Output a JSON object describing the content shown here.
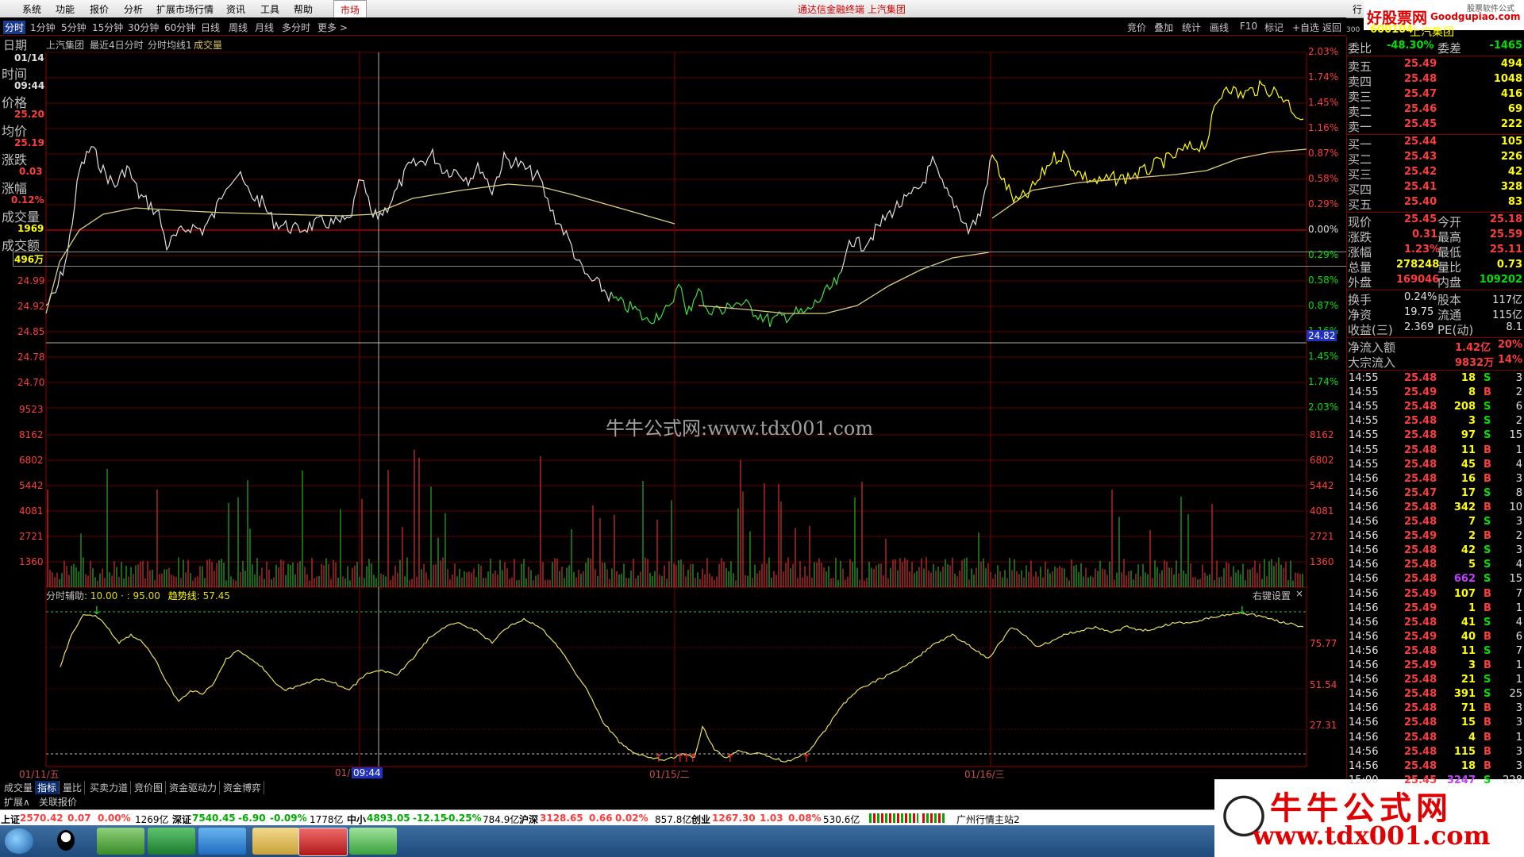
{
  "menu": {
    "items": [
      "系统",
      "功能",
      "报价",
      "分析",
      "扩展市场行情",
      "资讯",
      "工具",
      "帮助"
    ],
    "market_tab": "市场",
    "app_title": "通达信金融终端 上汽集团",
    "right_label": "行"
  },
  "top_logo": {
    "brand": "好股票网",
    "url": "Goodgupiao.com",
    "extra": "股票软件公式"
  },
  "toolbar": {
    "periods": [
      "分时",
      "1分钟",
      "5分钟",
      "15分钟",
      "30分钟",
      "60分钟",
      "日线",
      "周线",
      "月线",
      "多分时",
      "更多 >"
    ],
    "right": [
      "竞价",
      "叠加",
      "统计",
      "画线",
      "F10",
      "标记",
      "+自选",
      "返回"
    ]
  },
  "quote_header": {
    "code": "600104",
    "name": "上汽集团",
    "prefix": "300"
  },
  "chart_header": {
    "date_tab": "日期",
    "stock": "上汽集团",
    "desc": "最近4日分时",
    "line": "分时均线1",
    "vol": "成交量"
  },
  "info": {
    "date": "01/14",
    "time_label": "时间",
    "time": "09:44",
    "price_label": "价格",
    "price": "25.20",
    "avg_label": "均价",
    "avg": "25.19",
    "chg_label": "涨跌",
    "chg": "0.03",
    "pct_label": "涨幅",
    "pct": "0.12%",
    "vol_label": "成交量",
    "vol": "1969",
    "amt_label": "成交额",
    "amt": "496万"
  },
  "axis_left_price": [
    "24.99",
    "24.92",
    "24.85",
    "24.78",
    "24.70"
  ],
  "axis_left_vol": [
    "9523",
    "8162",
    "6802",
    "5442",
    "4081",
    "2721",
    "1360"
  ],
  "axis_right_pct": [
    "2.03%",
    "1.74%",
    "1.45%",
    "1.16%",
    "0.87%",
    "0.58%",
    "0.29%",
    "0.00%",
    "0.29%",
    "0.58%",
    "0.87%",
    "1.16%",
    "1.45%",
    "1.74%",
    "2.03%"
  ],
  "axis_right_vol": [
    "9523",
    "8162",
    "6802",
    "5442",
    "4081",
    "2721",
    "1360"
  ],
  "cursor_price": "24.82",
  "indicator": {
    "title": "分时辅助",
    "p1": ": 10.00",
    "p2": ": 95.00",
    "line_name": "趋势线",
    "line_val": ": 57.45",
    "right_key": "右键设置",
    "axis": [
      "75.77",
      "51.54",
      "27.31"
    ]
  },
  "dates": [
    "01/11/五",
    "01/1",
    "01/15/二",
    "01/16/三"
  ],
  "cursor_time": "09:44",
  "watermark": "牛牛公式网:www.tdx001.com",
  "tabs1": [
    "成交量",
    "指标",
    "量比",
    "买卖力道",
    "竞价图",
    "资金驱动力",
    "资金博弈"
  ],
  "tabs2": [
    "扩展∧",
    "关联报价"
  ],
  "status": {
    "sh_label": "上证",
    "sh": "2570.42",
    "sh_chg": "0.07",
    "sh_pct": "0.00%",
    "sh_amt": "1269亿",
    "sz_label": "深证",
    "sz": "7540.45",
    "sz_chg": "-6.90",
    "sz_pct": "-0.09%",
    "sz_amt": "1778亿",
    "zx_label": "中小",
    "zx": "4893.05",
    "zx_chg": "-12.15",
    "zx_pct": "-0.25%",
    "zx_amt": "784.9亿",
    "hs_label": "沪深",
    "hs": "3128.65",
    "hs_chg": "0.66",
    "hs_pct": "0.02%",
    "hs_amt": "857.8亿",
    "cy_label": "创业",
    "cy": "1267.30",
    "cy_chg": "1.03",
    "cy_pct": "0.08%",
    "cy_amt": "530.6亿",
    "server": "广州行情主站2"
  },
  "bottom_logo": {
    "t1": "牛牛公式网",
    "t2": "www.tdx001.com"
  },
  "rp": {
    "wb_label": "委比",
    "wb": "-48.30%",
    "wc_label": "委差",
    "wc": "-1465",
    "asks": [
      {
        "l": "卖五",
        "p": "25.49",
        "v": "494"
      },
      {
        "l": "卖四",
        "p": "25.48",
        "v": "1048"
      },
      {
        "l": "卖三",
        "p": "25.47",
        "v": "416"
      },
      {
        "l": "卖二",
        "p": "25.46",
        "v": "69"
      },
      {
        "l": "卖一",
        "p": "25.45",
        "v": "222"
      }
    ],
    "bids": [
      {
        "l": "买一",
        "p": "25.44",
        "v": "105"
      },
      {
        "l": "买二",
        "p": "25.43",
        "v": "226"
      },
      {
        "l": "买三",
        "p": "25.42",
        "v": "42"
      },
      {
        "l": "买四",
        "p": "25.41",
        "v": "328"
      },
      {
        "l": "买五",
        "p": "25.40",
        "v": "83"
      }
    ],
    "stats": [
      {
        "l1": "现价",
        "v1": "25.45",
        "l2": "今开",
        "v2": "25.18"
      },
      {
        "l1": "涨跌",
        "v1": "0.31",
        "l2": "最高",
        "v2": "25.59"
      },
      {
        "l1": "涨幅",
        "v1": "1.23%",
        "l2": "最低",
        "v2": "25.11"
      },
      {
        "l1": "总量",
        "v1": "278248",
        "l2": "量比",
        "v2": "0.73"
      },
      {
        "l1": "外盘",
        "v1": "169046",
        "l2": "内盘",
        "v2": "109202"
      }
    ],
    "stats2": [
      {
        "l1": "换手",
        "v1": "0.24%",
        "l2": "股本",
        "v2": "117亿"
      },
      {
        "l1": "净资",
        "v1": "19.75",
        "l2": "流通",
        "v2": "115亿"
      },
      {
        "l1": "收益(三)",
        "v1": "2.369",
        "l2": "PE(动)",
        "v2": "8.1"
      }
    ],
    "flow": [
      {
        "l": "净流入额",
        "v": "1.42亿",
        "p": "20%"
      },
      {
        "l": "大宗流入",
        "v": "9832万",
        "p": "14%"
      }
    ],
    "ticks": [
      [
        "14:55",
        "25.48",
        "18",
        "S",
        "3"
      ],
      [
        "14:55",
        "25.49",
        "8",
        "B",
        "2"
      ],
      [
        "14:55",
        "25.48",
        "208",
        "S",
        "6"
      ],
      [
        "14:55",
        "25.48",
        "3",
        "S",
        "2"
      ],
      [
        "14:55",
        "25.48",
        "97",
        "S",
        "15"
      ],
      [
        "14:55",
        "25.48",
        "11",
        "B",
        "1"
      ],
      [
        "14:55",
        "25.48",
        "45",
        "B",
        "4"
      ],
      [
        "14:56",
        "25.48",
        "16",
        "B",
        "3"
      ],
      [
        "14:56",
        "25.47",
        "17",
        "S",
        "8"
      ],
      [
        "14:56",
        "25.48",
        "342",
        "B",
        "10"
      ],
      [
        "14:56",
        "25.48",
        "7",
        "S",
        "3"
      ],
      [
        "14:56",
        "25.49",
        "2",
        "B",
        "2"
      ],
      [
        "14:56",
        "25.48",
        "42",
        "S",
        "3"
      ],
      [
        "14:56",
        "25.48",
        "5",
        "S",
        "4"
      ],
      [
        "14:56",
        "25.48",
        "662",
        "S",
        "15"
      ],
      [
        "14:56",
        "25.49",
        "107",
        "B",
        "7"
      ],
      [
        "14:56",
        "25.49",
        "1",
        "B",
        "1"
      ],
      [
        "14:56",
        "25.48",
        "41",
        "S",
        "4"
      ],
      [
        "14:56",
        "25.49",
        "40",
        "B",
        "6"
      ],
      [
        "14:56",
        "25.48",
        "11",
        "S",
        "7"
      ],
      [
        "14:56",
        "25.49",
        "3",
        "B",
        "1"
      ],
      [
        "14:56",
        "25.48",
        "21",
        "S",
        "1"
      ],
      [
        "14:56",
        "25.48",
        "391",
        "S",
        "25"
      ],
      [
        "14:56",
        "25.48",
        "71",
        "B",
        "3"
      ],
      [
        "14:56",
        "25.48",
        "15",
        "B",
        "3"
      ],
      [
        "14:56",
        "25.48",
        "4",
        "B",
        "1"
      ],
      [
        "14:56",
        "25.48",
        "115",
        "B",
        "3"
      ],
      [
        "14:56",
        "25.48",
        "18",
        "B",
        "3"
      ],
      [
        "15:00",
        "25.45",
        "3247",
        "S",
        "228"
      ]
    ]
  }
}
